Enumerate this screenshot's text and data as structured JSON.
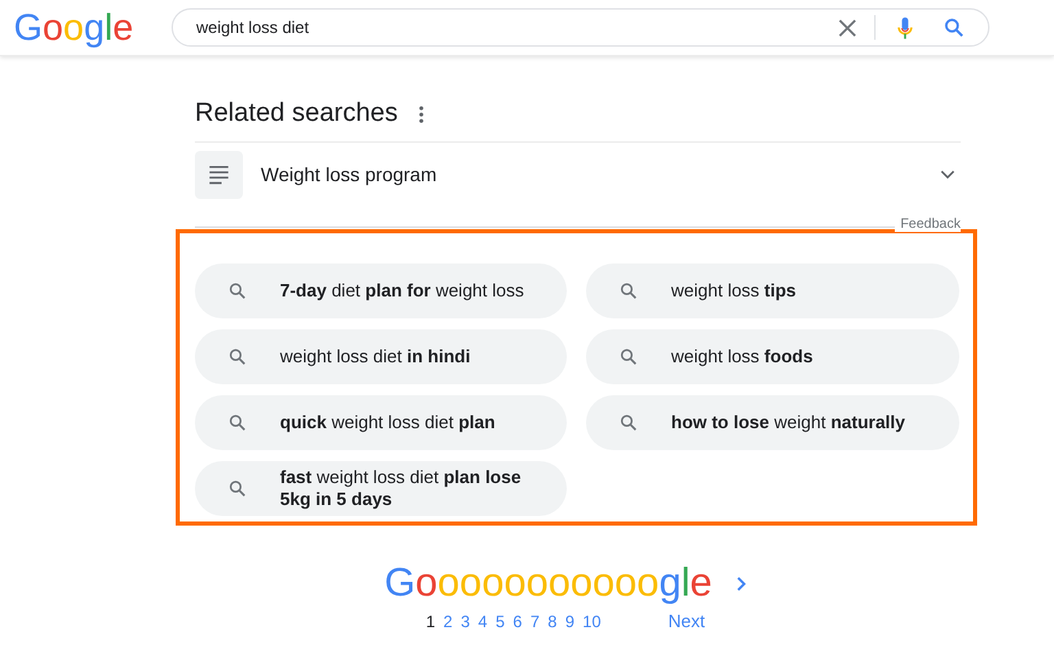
{
  "header": {
    "logo": [
      {
        "char": "G",
        "color": "#4285f4"
      },
      {
        "char": "o",
        "color": "#ea4335"
      },
      {
        "char": "o",
        "color": "#fbbc05"
      },
      {
        "char": "g",
        "color": "#4285f4"
      },
      {
        "char": "l",
        "color": "#34a853"
      },
      {
        "char": "e",
        "color": "#ea4335"
      }
    ],
    "search": {
      "value": "weight loss diet"
    }
  },
  "related": {
    "title": "Related searches",
    "accordion": [
      {
        "label": "Weight loss program",
        "expanded": false
      }
    ],
    "feedback": "Feedback",
    "highlighted": true,
    "chips": [
      {
        "text": "**7-day** diet **plan for** weight loss"
      },
      {
        "text": "weight loss **tips**"
      },
      {
        "text": "weight loss diet **in hindi**"
      },
      {
        "text": "weight loss **foods**"
      },
      {
        "text": "**quick** weight loss diet **plan**"
      },
      {
        "text": "**how to lose** weight **naturally**"
      },
      {
        "text": "**fast** weight loss diet **plan lose 5kg in 5 days**"
      }
    ]
  },
  "pagination": {
    "logo": [
      {
        "char": "G",
        "color": "#4285f4"
      },
      {
        "char": "o",
        "color": "#ea4335"
      },
      {
        "char": "o",
        "color": "#fbbc05"
      },
      {
        "char": "o",
        "color": "#fbbc05"
      },
      {
        "char": "o",
        "color": "#fbbc05"
      },
      {
        "char": "o",
        "color": "#fbbc05"
      },
      {
        "char": "o",
        "color": "#fbbc05"
      },
      {
        "char": "o",
        "color": "#fbbc05"
      },
      {
        "char": "o",
        "color": "#fbbc05"
      },
      {
        "char": "o",
        "color": "#fbbc05"
      },
      {
        "char": "o",
        "color": "#fbbc05"
      },
      {
        "char": "o",
        "color": "#fbbc05"
      },
      {
        "char": "g",
        "color": "#4285f4"
      },
      {
        "char": "l",
        "color": "#34a853"
      },
      {
        "char": "e",
        "color": "#ea4335"
      }
    ],
    "pages": [
      {
        "label": "1",
        "selected": true
      },
      {
        "label": "2",
        "selected": false
      },
      {
        "label": "3",
        "selected": false
      },
      {
        "label": "4",
        "selected": false
      },
      {
        "label": "5",
        "selected": false
      },
      {
        "label": "6",
        "selected": false
      },
      {
        "label": "7",
        "selected": false
      },
      {
        "label": "8",
        "selected": false
      },
      {
        "label": "9",
        "selected": false
      },
      {
        "label": "10",
        "selected": false
      }
    ],
    "next": "Next"
  }
}
